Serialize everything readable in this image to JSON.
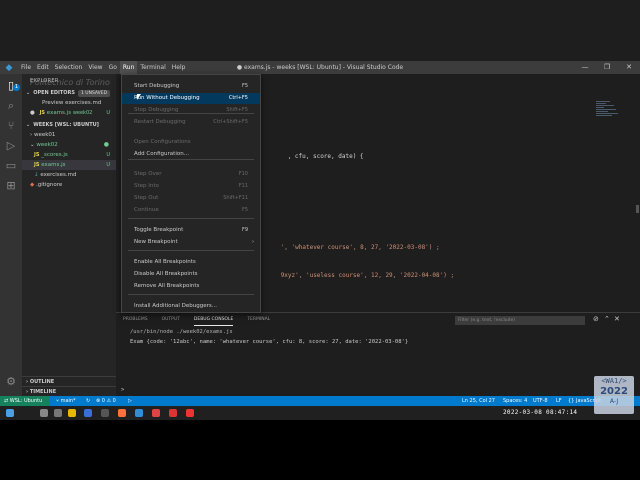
{
  "window": {
    "title": "● exams.js - weeks [WSL: Ubuntu] - Visual Studio Code",
    "menu": [
      "File",
      "Edit",
      "Selection",
      "View",
      "Go",
      "Run",
      "Terminal",
      "Help"
    ],
    "controls": [
      "—",
      "❐",
      "✕"
    ]
  },
  "sidebar": {
    "header": "EXPLORER",
    "open_editors": {
      "title": "OPEN EDITORS",
      "badge": "1 UNSAVED",
      "items": [
        {
          "label": "Preview exercises.md",
          "status": ""
        },
        {
          "label": "exams.js",
          "folder": "week02",
          "status": "U"
        }
      ]
    },
    "workspace": {
      "title": "WEEKS [WSL: UBUNTU]",
      "items": [
        {
          "label": "week01",
          "status": ""
        },
        {
          "label": "week02",
          "status": "●"
        },
        {
          "label": "_scores.js",
          "status": "U"
        },
        {
          "label": "exams.js",
          "status": "U"
        },
        {
          "label": "exercises.md",
          "status": ""
        },
        {
          "label": ".gitignore",
          "status": ""
        }
      ]
    },
    "outline": "OUTLINE",
    "timeline": "TIMELINE"
  },
  "watermark": "Politecnico di Torino",
  "editor": {
    "lines": [
      {
        "code": ", cfu, score, date) {"
      },
      {
        "code": "', 'whatever course', 8, 27, '2022-03-08') ;"
      },
      {
        "code": "9xyz', 'useless course', 12, 29, '2022-04-08') ;"
      }
    ]
  },
  "run_menu": {
    "items": [
      {
        "label": "Start Debugging",
        "shortcut": "F5",
        "disabled": false
      },
      {
        "label": "Run Without Debugging",
        "shortcut": "Ctrl+F5",
        "disabled": false,
        "highlighted": true
      },
      {
        "label": "Stop Debugging",
        "shortcut": "Shift+F5",
        "disabled": true
      },
      {
        "label": "Restart Debugging",
        "shortcut": "Ctrl+Shift+F5",
        "disabled": true
      },
      {
        "label": "Open Configurations",
        "shortcut": "",
        "disabled": true
      },
      {
        "label": "Add Configuration...",
        "shortcut": "",
        "disabled": false
      },
      {
        "label": "Step Over",
        "shortcut": "F10",
        "disabled": true
      },
      {
        "label": "Step Into",
        "shortcut": "F11",
        "disabled": true
      },
      {
        "label": "Step Out",
        "shortcut": "Shift+F11",
        "disabled": true
      },
      {
        "label": "Continue",
        "shortcut": "F5",
        "disabled": true
      },
      {
        "label": "Toggle Breakpoint",
        "shortcut": "F9",
        "disabled": false
      },
      {
        "label": "New Breakpoint",
        "shortcut": "",
        "disabled": false
      },
      {
        "label": "Enable All Breakpoints",
        "shortcut": "",
        "disabled": false
      },
      {
        "label": "Disable All Breakpoints",
        "shortcut": "",
        "disabled": false
      },
      {
        "label": "Remove All Breakpoints",
        "shortcut": "",
        "disabled": false
      },
      {
        "label": "Install Additional Debuggers...",
        "shortcut": "",
        "disabled": false
      }
    ]
  },
  "panel": {
    "tabs": [
      "PROBLEMS",
      "OUTPUT",
      "DEBUG CONSOLE",
      "TERMINAL"
    ],
    "active_tab": "DEBUG CONSOLE",
    "filter_placeholder": "Filter (e.g. text, !exclude)",
    "console": [
      "/usr/bin/node ./week02/exams.js",
      "Exam {code: '12abc', name: 'whatever course', cfu: 8, score: 27, date: '2022-03-08'}"
    ],
    "prompt": ">"
  },
  "statusbar": {
    "remote": "WSL: Ubuntu",
    "branch": "main*",
    "errors": "0",
    "warnings": "0",
    "position": "Ln 25, Col 27",
    "spaces": "Spaces: 4",
    "encoding": "UTF-8",
    "eol": "LF",
    "language": "JavaScript"
  },
  "taskbar": {
    "clock": "2022-03-08 08:47:14"
  },
  "wa_logo": {
    "line1": "<WA1/>",
    "line2": "2022",
    "line3": "A-J"
  },
  "colors": {
    "accent": "#007acc",
    "remote": "#16825d",
    "menu_highlight": "#04395e"
  }
}
